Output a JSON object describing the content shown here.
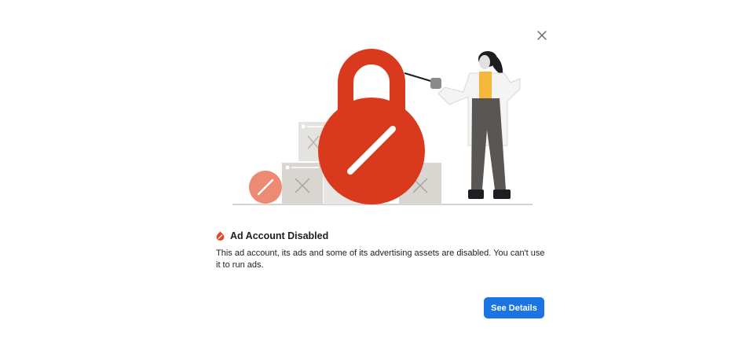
{
  "dialog": {
    "title": "Ad Account Disabled",
    "description": "This ad account, its ads and some of its advertising assets are disabled. You can't use it to run ads.",
    "primary_button_label": "See Details",
    "close_icon": "close-icon",
    "status_icon": "warning-icon"
  },
  "colors": {
    "accent": "#1b74e4",
    "lock_red": "#d93a1e",
    "badge_red": "#e04c2b",
    "text": "#1c1e21"
  }
}
